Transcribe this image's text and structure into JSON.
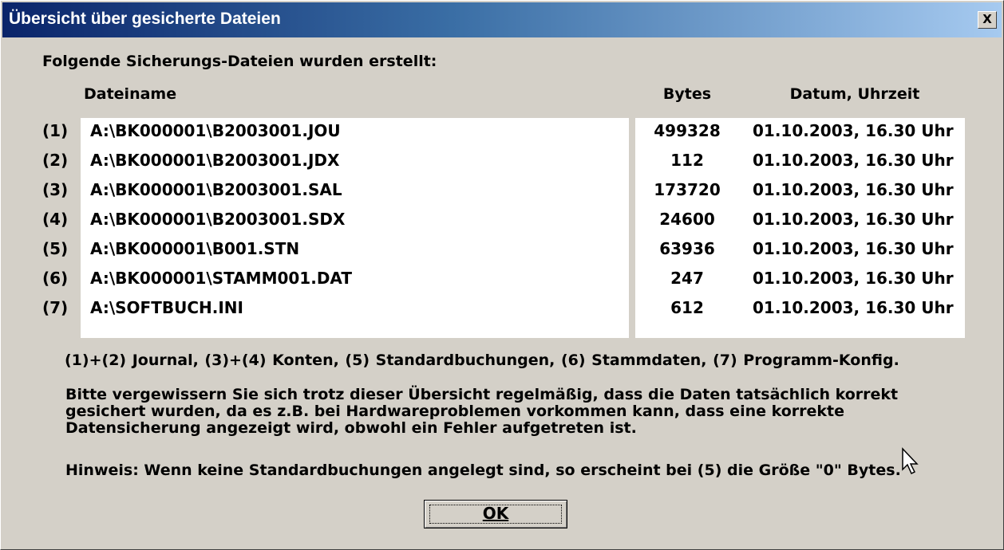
{
  "window": {
    "title": "Übersicht über gesicherte Dateien",
    "close_label": "X"
  },
  "intro": "Folgende Sicherungs-Dateien wurden erstellt:",
  "columns": {
    "filename": "Dateiname",
    "bytes": "Bytes",
    "date": "Datum, Uhrzeit"
  },
  "rows": [
    {
      "num": "(1)",
      "file": "A:\\BK000001\\B2003001.JOU",
      "bytes": "499328",
      "date": "01.10.2003, 16.30 Uhr"
    },
    {
      "num": "(2)",
      "file": "A:\\BK000001\\B2003001.JDX",
      "bytes": "112",
      "date": "01.10.2003, 16.30 Uhr"
    },
    {
      "num": "(3)",
      "file": "A:\\BK000001\\B2003001.SAL",
      "bytes": "173720",
      "date": "01.10.2003, 16.30 Uhr"
    },
    {
      "num": "(4)",
      "file": "A:\\BK000001\\B2003001.SDX",
      "bytes": "24600",
      "date": "01.10.2003, 16.30 Uhr"
    },
    {
      "num": "(5)",
      "file": "A:\\BK000001\\B001.STN",
      "bytes": "63936",
      "date": "01.10.2003, 16.30 Uhr"
    },
    {
      "num": "(6)",
      "file": "A:\\BK000001\\STAMM001.DAT",
      "bytes": "247",
      "date": "01.10.2003, 16.30 Uhr"
    },
    {
      "num": "(7)",
      "file": "A:\\SOFTBUCH.INI",
      "bytes": "612",
      "date": "01.10.2003, 16.30 Uhr"
    }
  ],
  "legend": "(1)+(2) Journal,   (3)+(4) Konten,   (5) Standardbuchungen,   (6) Stammdaten,   (7) Programm-Konfig.",
  "warning": "Bitte vergewissern Sie sich trotz dieser Übersicht regelmäßig, dass die Daten tatsächlich korrekt gesichert wurden, da es z.B. bei Hardwareproblemen vorkommen kann, dass eine korrekte Datensicherung angezeigt wird, obwohl ein Fehler aufgetreten ist.",
  "hint": "Hinweis: Wenn keine Standardbuchungen angelegt sind, so erscheint bei (5) die Größe \"0\" Bytes.",
  "ok_label": "OK",
  "icons": {
    "close": "close-icon",
    "cursor": "mouse-pointer-icon"
  }
}
